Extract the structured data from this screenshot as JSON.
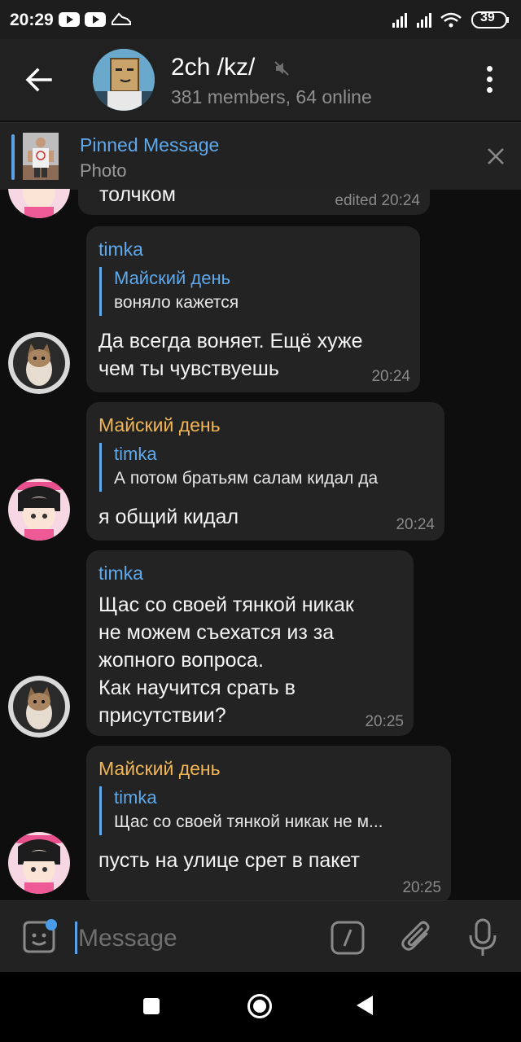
{
  "status_bar": {
    "time": "20:29",
    "battery": "39"
  },
  "header": {
    "title": "2ch /kz/",
    "subtitle": "381 members, 64 online"
  },
  "pinned": {
    "title": "Pinned Message",
    "subtitle": "Photo"
  },
  "messages": [
    {
      "text": "толчком",
      "time": "edited 20:24"
    },
    {
      "sender": "timka",
      "reply_name": "Майский день",
      "reply_text": "воняло кажется",
      "text": "Да всегда воняет. Ещё хуже\nчем ты чувствуешь",
      "time": "20:24"
    },
    {
      "sender": "Майский день",
      "reply_name": "timka",
      "reply_text": "А потом братьям салам кидал да",
      "text": "я общий кидал",
      "time": "20:24"
    },
    {
      "sender": "timka",
      "text": "Щас со своей тянкой никак\nне можем съехатся из за\nжопного вопроса.\nКак научится срать в\nприсутствии?",
      "time": "20:25"
    },
    {
      "sender": "Майский день",
      "reply_name": "timka",
      "reply_text": "Щас со своей тянкой никак не м...",
      "text": "пусть на улице срет в пакет",
      "time": "20:25"
    }
  ],
  "input": {
    "placeholder": "Message"
  },
  "colors": {
    "accent_blue": "#5fa9ed",
    "accent_orange": "#f2b654",
    "bubble": "#232323",
    "background": "#0e0e0e"
  }
}
